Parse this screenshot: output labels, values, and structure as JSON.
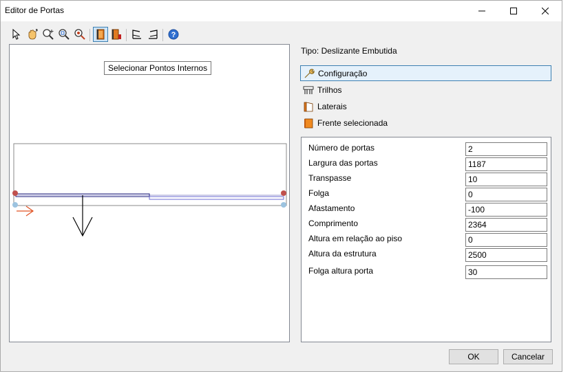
{
  "window": {
    "title": "Editor de Portas"
  },
  "toolbar": {
    "icons": [
      "cursor-icon",
      "pan-hand-icon",
      "zoom-in-icon",
      "zoom-window-icon",
      "zoom-fit-icon",
      "select-internal-points-icon",
      "door-frame-icon",
      "door-open-left-icon",
      "door-open-right-icon",
      "help-icon"
    ],
    "active": "select-internal-points-icon"
  },
  "tooltip": {
    "text": "Selecionar Pontos Internos"
  },
  "type_label": "Tipo: Deslizante Embutida",
  "sections": [
    {
      "label": "Configuração",
      "icon": "wrench-icon",
      "selected": true
    },
    {
      "label": "Trilhos",
      "icon": "rails-icon",
      "selected": false
    },
    {
      "label": "Laterais",
      "icon": "sides-icon",
      "selected": false
    },
    {
      "label": "Frente selecionada",
      "icon": "front-panel-icon",
      "selected": false
    }
  ],
  "properties": [
    {
      "label": "Número de portas",
      "value": "2"
    },
    {
      "label": "Largura das portas",
      "value": "1187"
    },
    {
      "label": "Transpasse",
      "value": "10"
    },
    {
      "label": "Folga",
      "value": "0"
    },
    {
      "label": "Afastamento",
      "value": "-100"
    },
    {
      "label": "Comprimento",
      "value": "2364"
    },
    {
      "label": "Altura em relação ao piso",
      "value": "0"
    },
    {
      "label": "Altura da estrutura",
      "value": "2500"
    },
    {
      "label": "Folga altura porta",
      "value": "30"
    }
  ],
  "buttons": {
    "ok": "OK",
    "cancel": "Cancelar"
  },
  "colors": {
    "accent": "#3c7fb1",
    "point_red": "#c0504d",
    "point_blue": "#9cc3e0",
    "door_line": "#1a1a7a",
    "arrow_orange": "#e05020"
  }
}
